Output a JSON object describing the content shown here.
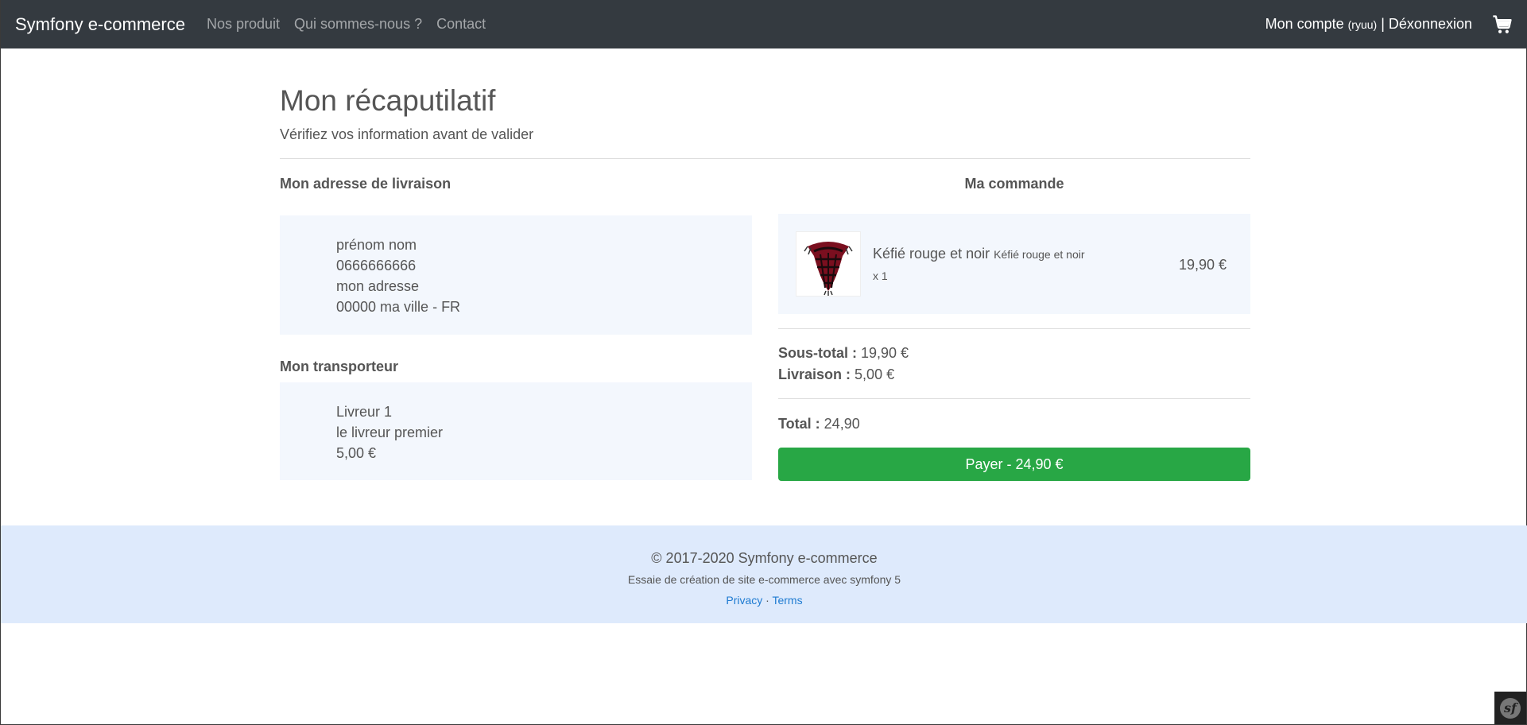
{
  "navbar": {
    "brand": "Symfony e-commerce",
    "links": [
      "Nos produit",
      "Qui sommes-nous ?",
      "Contact"
    ],
    "account_label": "Mon compte",
    "account_user": "(ryuu)",
    "separator": "|",
    "logout_label": "Déxonnexion",
    "cart_icon": "cart-icon"
  },
  "header": {
    "title": "Mon récaputilatif",
    "subtitle": "Vérifiez vos information avant de valider"
  },
  "delivery": {
    "title": "Mon adresse de livraison",
    "lines": [
      "prénom nom",
      "0666666666",
      "mon adresse",
      "00000 ma ville - FR"
    ]
  },
  "carrier": {
    "title": "Mon transporteur",
    "lines": [
      "Livreur 1",
      "le livreur premier",
      "5,00 €"
    ]
  },
  "order": {
    "title": "Ma commande",
    "item": {
      "name": "Kéfié rouge et noir",
      "subtitle": "Kéfié rouge et noir",
      "qty": "x 1",
      "price": "19,90 €"
    },
    "subtotal_label": "Sous-total :",
    "subtotal_value": "19,90 €",
    "shipping_label": "Livraison :",
    "shipping_value": "5,00 €",
    "total_label": "Total :",
    "total_value": "24,90",
    "pay_button": "Payer - 24,90 €"
  },
  "footer": {
    "copyright": "© 2017-2020 Symfony e-commerce",
    "description": "Essaie de création de site e-commerce avec symfony 5",
    "privacy": "Privacy",
    "dot": "·",
    "terms": "Terms"
  },
  "colors": {
    "navbar": "#343a40",
    "panel": "#f3f7fd",
    "pay": "#28a745",
    "footer": "#deeafc",
    "link": "#1e7bd1"
  }
}
